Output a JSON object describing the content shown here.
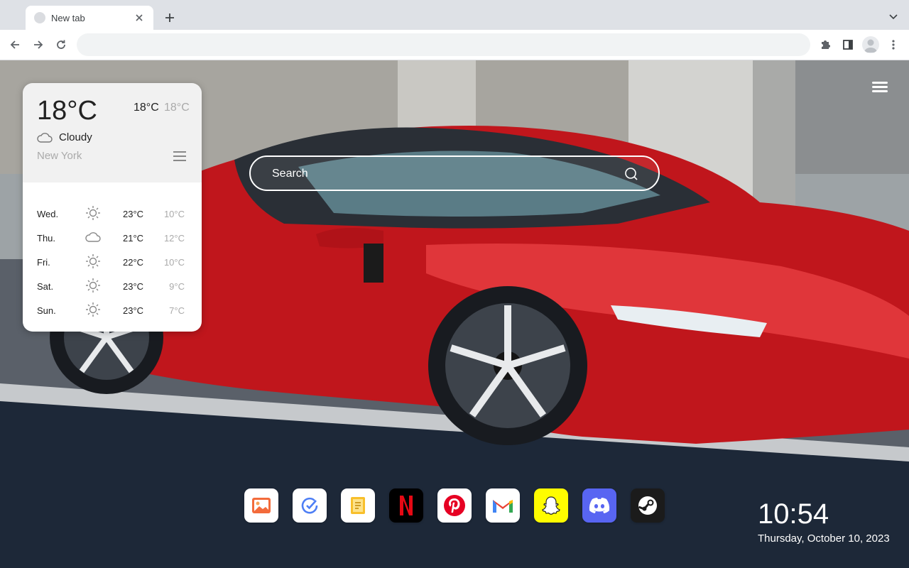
{
  "browser": {
    "tab": {
      "title": "New tab",
      "favicon": "globe-icon",
      "close_icon": "close-icon"
    },
    "new_tab_icon": "plus-icon",
    "tab_search_icon": "chevron-down-icon",
    "toolbar": {
      "back_icon": "arrow-left-icon",
      "forward_icon": "arrow-right-icon",
      "reload_icon": "reload-icon",
      "address_value": "",
      "extensions_icon": "puzzle-icon",
      "side_panel_icon": "side-panel-icon",
      "profile_icon": "avatar-icon",
      "menu_icon": "kebab-menu-icon"
    }
  },
  "weather": {
    "current_temp": "18°C",
    "high": "18°C",
    "low": "18°C",
    "condition": "Cloudy",
    "city": "New York",
    "forecast": [
      {
        "day": "Wed.",
        "icon": "sun-icon",
        "high": "23°C",
        "low": "10°C"
      },
      {
        "day": "Thu.",
        "icon": "cloud-icon",
        "high": "21°C",
        "low": "12°C"
      },
      {
        "day": "Fri.",
        "icon": "sun-icon",
        "high": "22°C",
        "low": "10°C"
      },
      {
        "day": "Sat.",
        "icon": "sun-icon",
        "high": "23°C",
        "low": "9°C"
      },
      {
        "day": "Sun.",
        "icon": "sun-icon",
        "high": "23°C",
        "low": "7°C"
      }
    ]
  },
  "search": {
    "placeholder": "Search"
  },
  "dock": [
    {
      "name": "Gallery",
      "icon": "image-icon",
      "color": "#ffffff"
    },
    {
      "name": "Tasks",
      "icon": "check-icon",
      "color": "#ffffff"
    },
    {
      "name": "Notes",
      "icon": "note-icon",
      "color": "#ffffff"
    },
    {
      "name": "Netflix",
      "icon": "netflix-icon",
      "color": "#000000"
    },
    {
      "name": "Pinterest",
      "icon": "pinterest-icon",
      "color": "#ffffff"
    },
    {
      "name": "Gmail",
      "icon": "gmail-icon",
      "color": "#ffffff"
    },
    {
      "name": "Snapchat",
      "icon": "snapchat-icon",
      "color": "#fffc00"
    },
    {
      "name": "Discord",
      "icon": "discord-icon",
      "color": "#5865f2"
    },
    {
      "name": "Steam",
      "icon": "steam-icon",
      "color": "#171a21"
    }
  ],
  "clock": {
    "time": "10:54",
    "date": "Thursday, October 10, 2023"
  },
  "page_menu_icon": "hamburger-menu-icon"
}
